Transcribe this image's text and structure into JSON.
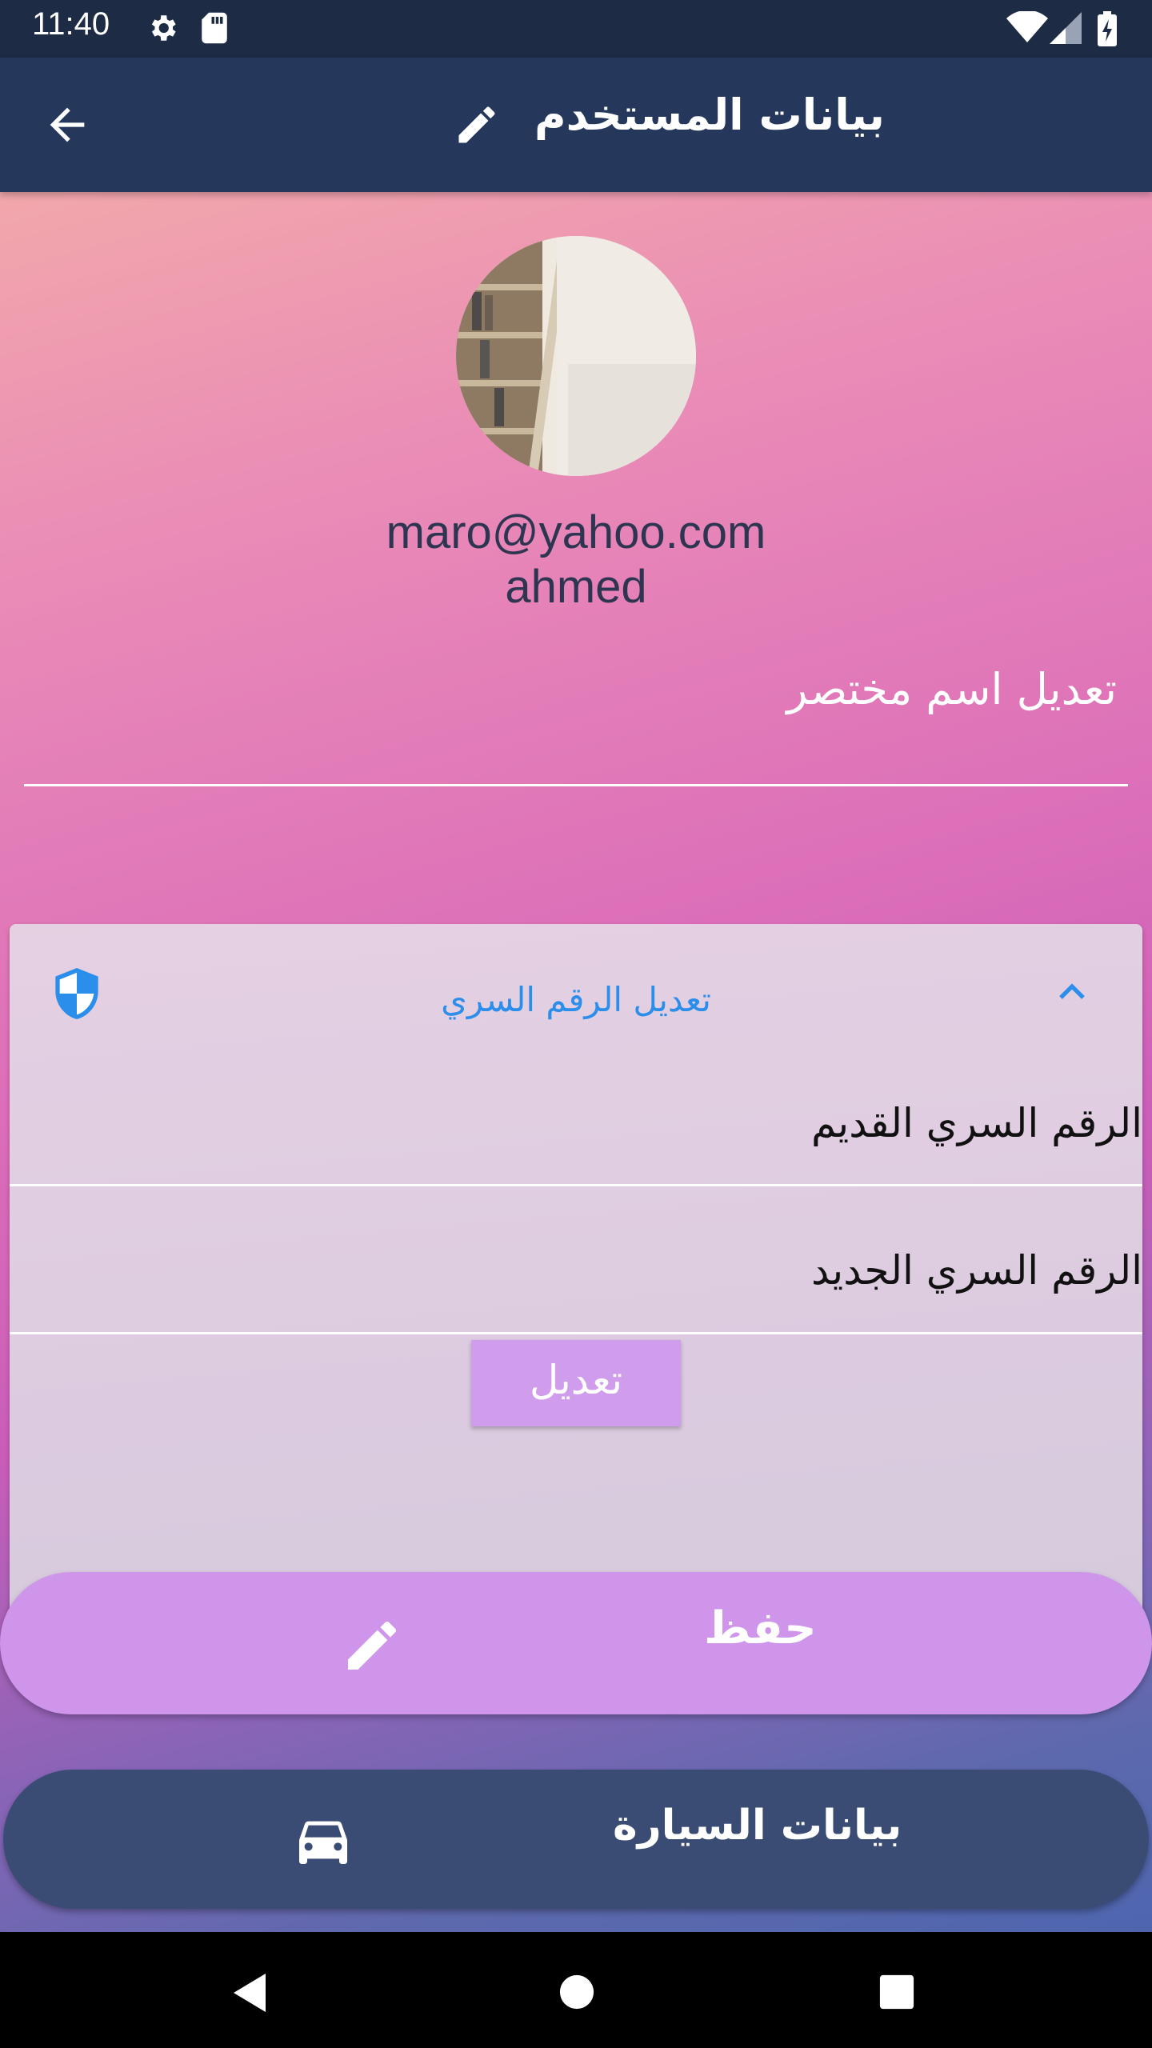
{
  "status_bar": {
    "time": "11:40",
    "icons": [
      "settings-icon",
      "sd-card-icon",
      "wifi-icon",
      "cell-signal-icon",
      "battery-charging-icon"
    ]
  },
  "app_bar": {
    "title": "بيانات المستخدم",
    "back_icon": "arrow-back-icon",
    "edit_icon": "pencil-icon"
  },
  "profile": {
    "email": "maro@yahoo.com",
    "name": "ahmed"
  },
  "nickname_field": {
    "label": "تعديل اسم مختصر"
  },
  "password_panel": {
    "title": "تعديل الرقم السري",
    "old_password_label": "الرقم السري القديم",
    "new_password_label": "الرقم السري الجديد",
    "submit_label": "تعديل",
    "expanded": true
  },
  "actions": {
    "save_label": "حفظ",
    "car_data_label": "بيانات السيارة"
  },
  "colors": {
    "app_bar": "#25375a",
    "status_bar": "#1e2b45",
    "accent_blue": "#2b8eea",
    "button_purple": "#cf95eb",
    "dark_button": "#3b4c74"
  }
}
